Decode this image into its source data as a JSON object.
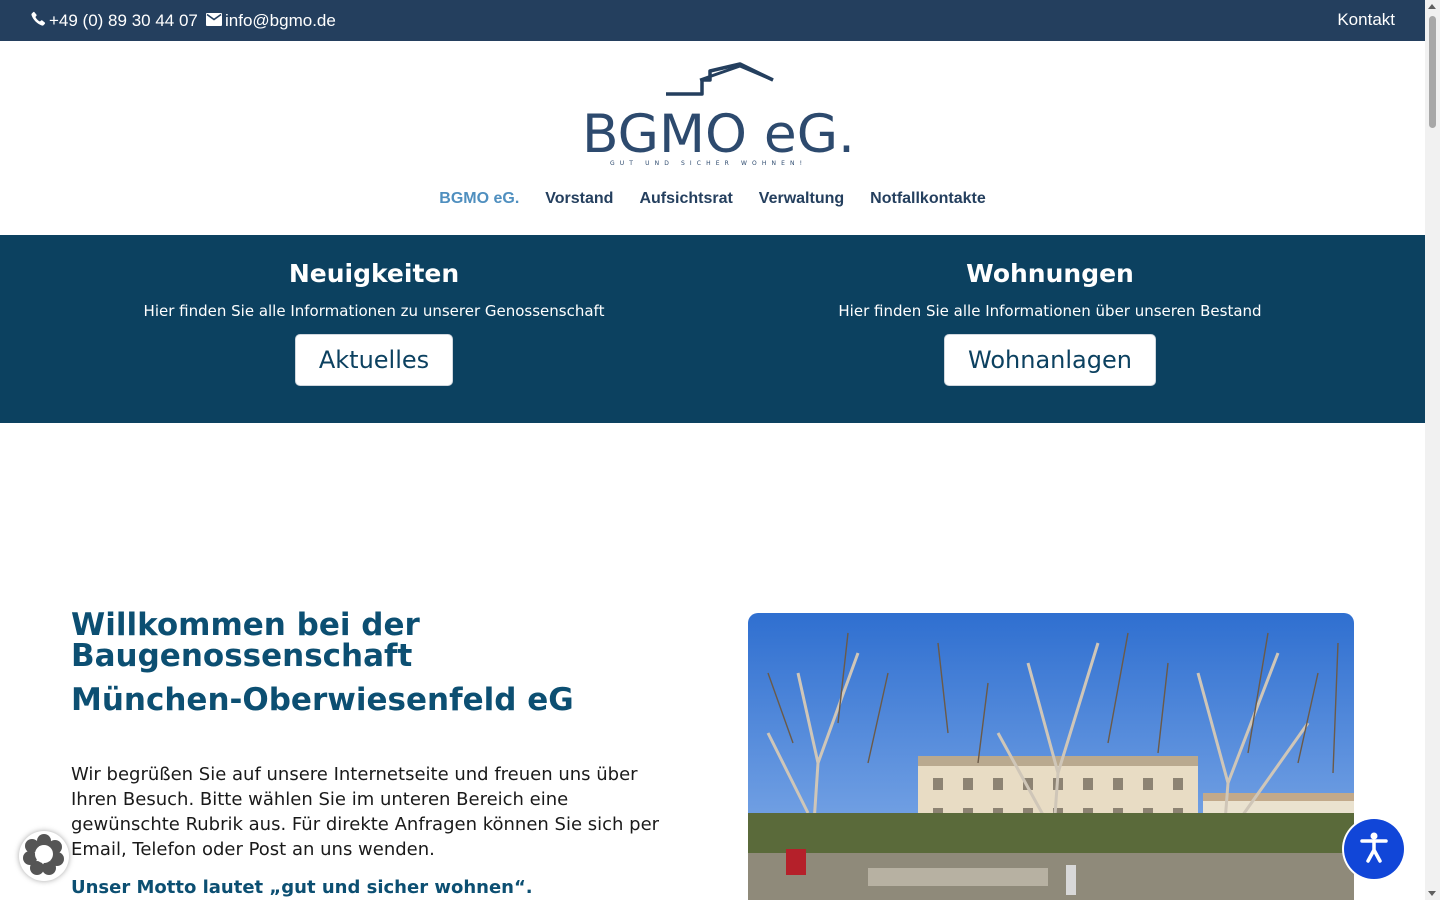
{
  "topbar": {
    "phone": "+49 (0) 89 30 44 07",
    "email": "info@bgmo.de",
    "kontakt": "Kontakt"
  },
  "logo": {
    "text": "BGMO eG.",
    "tagline": "GUT UND SICHER WOHNEN!"
  },
  "nav": {
    "items": [
      "BGMO eG.",
      "Vorstand",
      "Aufsichtsrat",
      "Verwaltung",
      "Notfallkontakte"
    ],
    "active_index": 0
  },
  "band": {
    "left": {
      "title": "Neuigkeiten",
      "text": "Hier finden Sie alle Informationen zu unserer Genossenschaft",
      "button": "Aktuelles"
    },
    "right": {
      "title": "Wohnungen",
      "text": "Hier finden Sie alle Informationen über unseren Bestand",
      "button": "Wohnanlagen"
    }
  },
  "welcome": {
    "title": "Willkommen bei der Baugenossenschaft",
    "subtitle": "München-Oberwiesenfeld eG",
    "body": "Wir begrüßen Sie auf unsere Internetseite und freuen uns über Ihren Besuch. Bitte wählen Sie im unteren Bereich eine gewünschte Rubrik aus. Für direkte Anfragen können Sie sich per Email, Telefon oder Post an uns wenden.",
    "motto": "Unser Motto lautet „gut und sicher wohnen“."
  },
  "colors": {
    "topbar": "#243f5e",
    "band": "#0c4160",
    "heading": "#0c4f72",
    "nav_active": "#4f8fbf",
    "a11y_button": "#1146d8"
  }
}
